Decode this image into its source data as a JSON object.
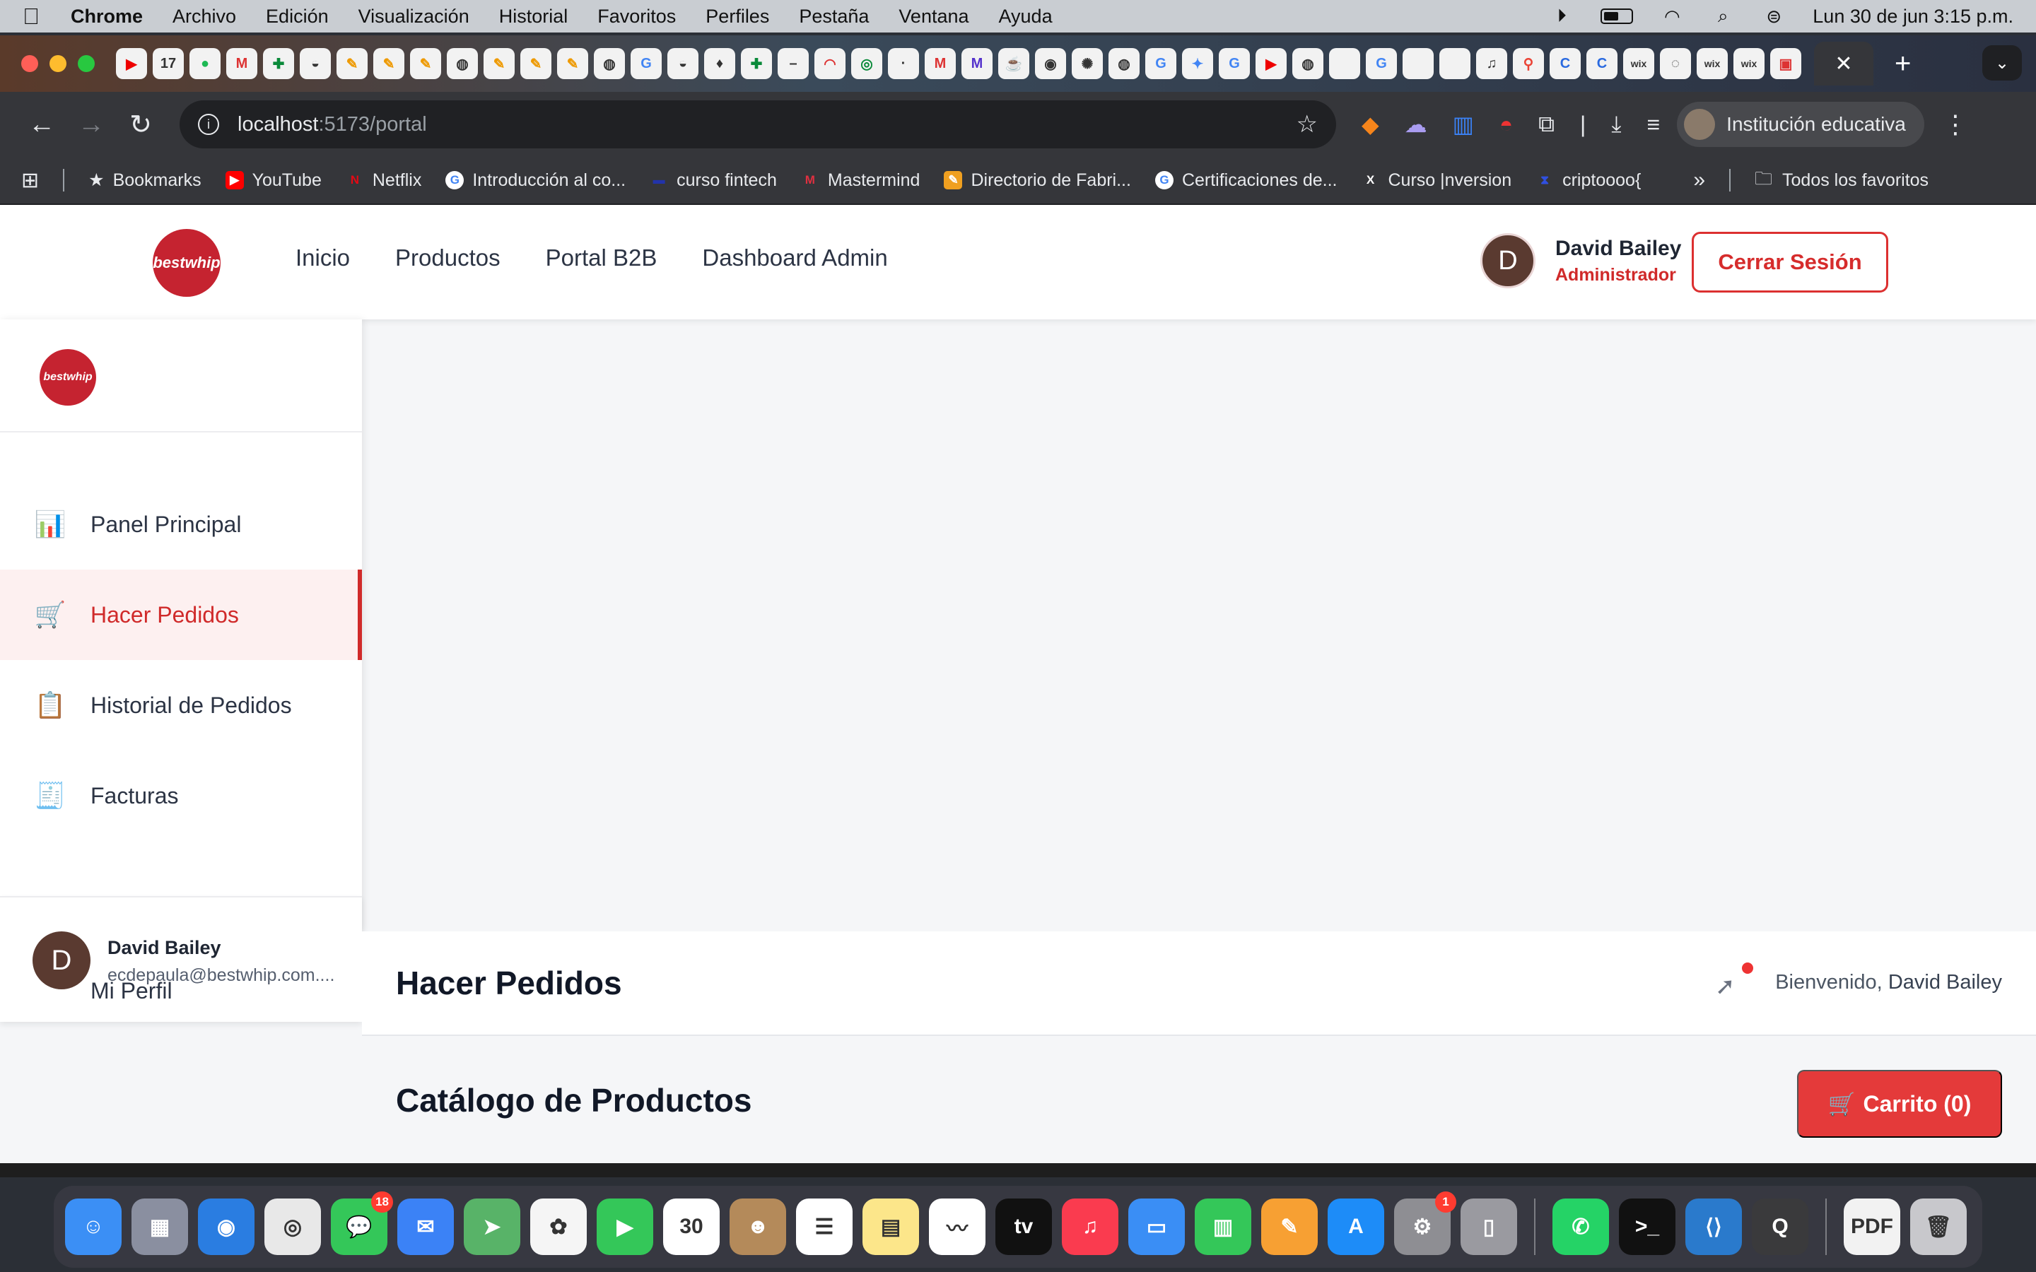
{
  "menubar": {
    "app": "Chrome",
    "items": [
      "Archivo",
      "Edición",
      "Visualización",
      "Historial",
      "Favoritos",
      "Perfiles",
      "Pestaña",
      "Ventana",
      "Ayuda"
    ],
    "datetime": "Lun 30 de jun  3:15 p.m."
  },
  "browser": {
    "url_host": "localhost",
    "url_path": ":5173/portal",
    "profile_label": "Institución educativa"
  },
  "bookmarks": [
    {
      "label": "Bookmarks",
      "icon": "star-icon",
      "color": "#9aa0a6"
    },
    {
      "label": "YouTube",
      "icon": "youtube-icon",
      "color": "#ff0000"
    },
    {
      "label": "Netflix",
      "icon": "netflix-icon",
      "color": "#e50914"
    },
    {
      "label": "Introducción al co...",
      "icon": "google-icon",
      "color": "#4285f4"
    },
    {
      "label": "curso fintech",
      "icon": "fintech-icon",
      "color": "#2233aa"
    },
    {
      "label": "Mastermind",
      "icon": "mastermind-icon",
      "color": "#e03040"
    },
    {
      "label": "Directorio de Fabri...",
      "icon": "directory-icon",
      "color": "#f0a020"
    },
    {
      "label": "Certificaciones de...",
      "icon": "google-icon",
      "color": "#4285f4"
    },
    {
      "label": "Curso |nversion",
      "icon": "x-icon",
      "color": "#000000"
    },
    {
      "label": "criptoooo{",
      "icon": "crypto-icon",
      "color": "#3050e0"
    }
  ],
  "bookmarks_all": "Todos los favoritos",
  "topnav": {
    "links": [
      "Inicio",
      "Productos",
      "Portal B2B",
      "Dashboard Admin"
    ],
    "user_initial": "D",
    "user_name": "David Bailey",
    "user_role": "Administrador",
    "logout_label": "Cerrar Sesión",
    "logo_text": "bestwhip"
  },
  "sidebar": {
    "items": [
      {
        "label": "Panel Principal",
        "icon": "bar-chart-icon",
        "glyph": "📊"
      },
      {
        "label": "Hacer Pedidos",
        "icon": "shopping-cart-icon",
        "glyph": "🛒"
      },
      {
        "label": "Historial de Pedidos",
        "icon": "clipboard-icon",
        "glyph": "📋"
      },
      {
        "label": "Facturas",
        "icon": "receipt-icon",
        "glyph": "🧾"
      },
      {
        "label": "Mi Perfil",
        "icon": "user-icon",
        "glyph": "👤"
      }
    ],
    "footer_initial": "D",
    "footer_name": "David Bailey",
    "footer_email": "ecdepaula@bestwhip.com...."
  },
  "main": {
    "title": "Hacer Pedidos",
    "welcome_prefix": "Bienvenido,",
    "welcome_name": "David Bailey",
    "catalog_title": "Catálogo de Productos",
    "cart_label": "Carrito (0)",
    "cart_icon_glyph": "🛒"
  },
  "dock": {
    "apps": [
      {
        "name": "finder",
        "color": "#3b8ff5",
        "glyph": "☺"
      },
      {
        "name": "launchpad",
        "color": "#8a8fa0",
        "glyph": "▦"
      },
      {
        "name": "safari",
        "color": "#2a7de1",
        "glyph": "◉"
      },
      {
        "name": "chrome",
        "color": "#e8e8e8",
        "glyph": "◎"
      },
      {
        "name": "messages",
        "color": "#34c759",
        "glyph": "💬",
        "badge": "18"
      },
      {
        "name": "mail",
        "color": "#3b82f6",
        "glyph": "✉"
      },
      {
        "name": "maps",
        "color": "#58b368",
        "glyph": "➤"
      },
      {
        "name": "photos",
        "color": "#f5f5f5",
        "glyph": "✿"
      },
      {
        "name": "facetime",
        "color": "#34c759",
        "glyph": "▶"
      },
      {
        "name": "calendar",
        "color": "#ffffff",
        "glyph": "30"
      },
      {
        "name": "contacts",
        "color": "#b48a5a",
        "glyph": "☻"
      },
      {
        "name": "reminders",
        "color": "#ffffff",
        "glyph": "☰"
      },
      {
        "name": "notes",
        "color": "#fce68a",
        "glyph": "▤"
      },
      {
        "name": "freeform",
        "color": "#ffffff",
        "glyph": "〰"
      },
      {
        "name": "tv",
        "color": "#111111",
        "glyph": "tv"
      },
      {
        "name": "music",
        "color": "#fa3b4f",
        "glyph": "♫"
      },
      {
        "name": "keynote",
        "color": "#3a8ef5",
        "glyph": "▭"
      },
      {
        "name": "numbers",
        "color": "#34c759",
        "glyph": "▥"
      },
      {
        "name": "pages",
        "color": "#f7a033",
        "glyph": "✎"
      },
      {
        "name": "app-store",
        "color": "#1d8cf8",
        "glyph": "A"
      },
      {
        "name": "settings",
        "color": "#8e8e93",
        "glyph": "⚙",
        "badge": "1"
      },
      {
        "name": "iphone-mirroring",
        "color": "#9a9aa0",
        "glyph": "▯"
      },
      {
        "name": "whatsapp",
        "color": "#25d366",
        "glyph": "✆"
      },
      {
        "name": "terminal",
        "color": "#111111",
        "glyph": ">_"
      },
      {
        "name": "vscode",
        "color": "#2a7acc",
        "glyph": "⟨⟩"
      },
      {
        "name": "quicktime",
        "color": "#3a3a3c",
        "glyph": "Q"
      },
      {
        "name": "pdf",
        "color": "#f2f2f2",
        "glyph": "PDF"
      },
      {
        "name": "trash",
        "color": "#c8c8cc",
        "glyph": "🗑"
      }
    ]
  },
  "colors": {
    "brand_red": "#d02a2a",
    "cart_red": "#e43a3a",
    "text_dark": "#111827"
  }
}
